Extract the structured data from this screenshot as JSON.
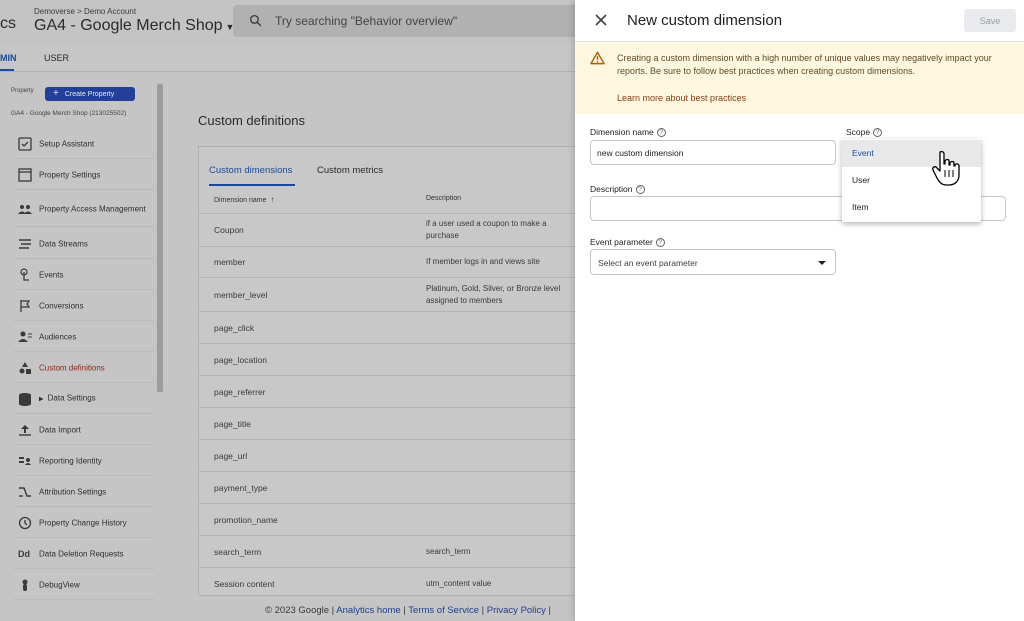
{
  "topbar": {
    "app_name_fragment": "cs",
    "breadcrumb": "Demoverse > Demo Account",
    "property_title": "GA4 - Google Merch Shop",
    "search_placeholder": "Try searching \"Behavior overview\""
  },
  "admin_tabs": {
    "admin": "MIN",
    "user": "USER"
  },
  "sidebar": {
    "property_label": "Property",
    "create_property_label": "Create Property",
    "property_id_text": "GA4 - Google Merch Shop (213025502)",
    "items": [
      {
        "label": "Setup Assistant",
        "icon": "checklist-icon"
      },
      {
        "label": "Property Settings",
        "icon": "settings-window-icon"
      },
      {
        "label": "Property Access Management",
        "icon": "people-icon"
      },
      {
        "label": "Data Streams",
        "icon": "streams-icon"
      },
      {
        "label": "Events",
        "icon": "touch-icon"
      },
      {
        "label": "Conversions",
        "icon": "flag-icon"
      },
      {
        "label": "Audiences",
        "icon": "audience-icon"
      },
      {
        "label": "Custom definitions",
        "icon": "shapes-icon"
      },
      {
        "label": "Data Settings",
        "icon": "database-icon"
      },
      {
        "label": "Data Import",
        "icon": "upload-icon"
      },
      {
        "label": "Reporting Identity",
        "icon": "identity-icon"
      },
      {
        "label": "Attribution Settings",
        "icon": "attribution-icon"
      },
      {
        "label": "Property Change History",
        "icon": "history-icon"
      },
      {
        "label": "Data Deletion Requests",
        "icon": "dd-icon"
      },
      {
        "label": "DebugView",
        "icon": "debug-icon"
      }
    ]
  },
  "main": {
    "title": "Custom definitions",
    "tabs": [
      "Custom dimensions",
      "Custom metrics"
    ],
    "columns": [
      "Dimension name",
      "Description"
    ],
    "rows": [
      {
        "name": "Coupon",
        "desc": "if a user used a coupon to make a purchase"
      },
      {
        "name": "member",
        "desc": "If member logs in and views site"
      },
      {
        "name": "member_level",
        "desc": "Platinum, Gold, Silver, or Bronze level assigned to members"
      },
      {
        "name": "page_click",
        "desc": ""
      },
      {
        "name": "page_location",
        "desc": ""
      },
      {
        "name": "page_referrer",
        "desc": ""
      },
      {
        "name": "page_title",
        "desc": ""
      },
      {
        "name": "page_url",
        "desc": ""
      },
      {
        "name": "payment_type",
        "desc": ""
      },
      {
        "name": "promotion_name",
        "desc": ""
      },
      {
        "name": "search_term",
        "desc": "search_term"
      },
      {
        "name": "Session content",
        "desc": "utm_content value"
      }
    ]
  },
  "footer": {
    "copyright": "© 2023 Google | ",
    "analytics_home": "Analytics home",
    "sep1": " | ",
    "terms": "Terms of Service",
    "sep2": " | ",
    "privacy": "Privacy Policy",
    "sep3": " | "
  },
  "panel": {
    "title": "New custom dimension",
    "save_label": "Save",
    "warning_text": "Creating a custom dimension with a high number of unique values may negatively impact your reports. Be sure to follow best practices when creating custom dimensions.",
    "warning_link": "Learn more about best practices",
    "dimension_name_label": "Dimension name",
    "dimension_name_value": "new custom dimension",
    "scope_label": "Scope",
    "scope_options": [
      "Event",
      "User",
      "Item"
    ],
    "description_label": "Description",
    "description_value": "",
    "event_parameter_label": "Event parameter",
    "event_parameter_placeholder": "Select an event parameter",
    "help_glyph": "?"
  },
  "colors": {
    "accent_blue": "#1a73e8",
    "warning_bg": "#fef7e0",
    "warning_icon": "#b06000",
    "active_sidebar": "#c5221f"
  }
}
